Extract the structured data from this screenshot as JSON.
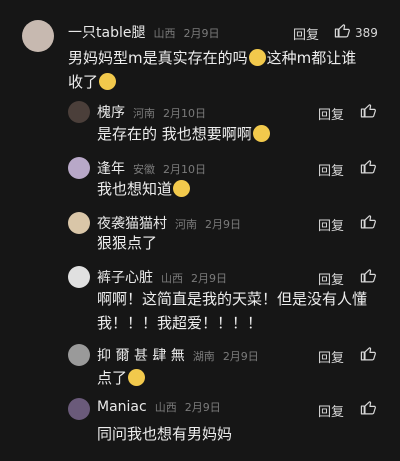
{
  "comments": [
    {
      "user": "一只table腿",
      "location": "山西",
      "date": "2月9日",
      "reply_label": "回复",
      "like_count": "389",
      "text_parts": [
        "男妈妈型m是真实存在的吗",
        "这种m都让谁收了"
      ],
      "avatar_color": "#c7b9b0"
    },
    {
      "user": "槐序",
      "location": "河南",
      "date": "2月10日",
      "reply_label": "回复",
      "text_parts": [
        "是存在的 我也想要啊啊"
      ],
      "avatar_color": "#4b3f3a"
    },
    {
      "user": "逢年",
      "location": "安徽",
      "date": "2月10日",
      "reply_label": "回复",
      "text_parts": [
        "我也想知道"
      ],
      "avatar_color": "#b8a8c8"
    },
    {
      "user": "夜袭猫猫村",
      "location": "河南",
      "date": "2月9日",
      "reply_label": "回复",
      "text_parts": [
        "狠狠点了"
      ],
      "avatar_color": "#d9c6a8"
    },
    {
      "user": "裤子心脏",
      "location": "山西",
      "date": "2月9日",
      "reply_label": "回复",
      "text_lines": [
        "啊啊！这简直是我的天菜！但是没有人懂",
        "我！！！我超爱！！！！"
      ],
      "avatar_color": "#e0e0e0"
    },
    {
      "user": "抑 爾 甚 肆 無",
      "location": "湖南",
      "date": "2月9日",
      "reply_label": "回复",
      "text_parts": [
        "点了"
      ],
      "avatar_color": "#9a9a9a"
    },
    {
      "user": "Maniac",
      "location": "山西",
      "date": "2月9日",
      "reply_label": "回复",
      "text_parts": [
        "同问我也想有男妈妈"
      ],
      "avatar_color": "#6a5a7a"
    }
  ],
  "colors": {
    "background": "#161616",
    "muted": "#7b7b7b",
    "emoji_yellow": "#f2c94c"
  }
}
